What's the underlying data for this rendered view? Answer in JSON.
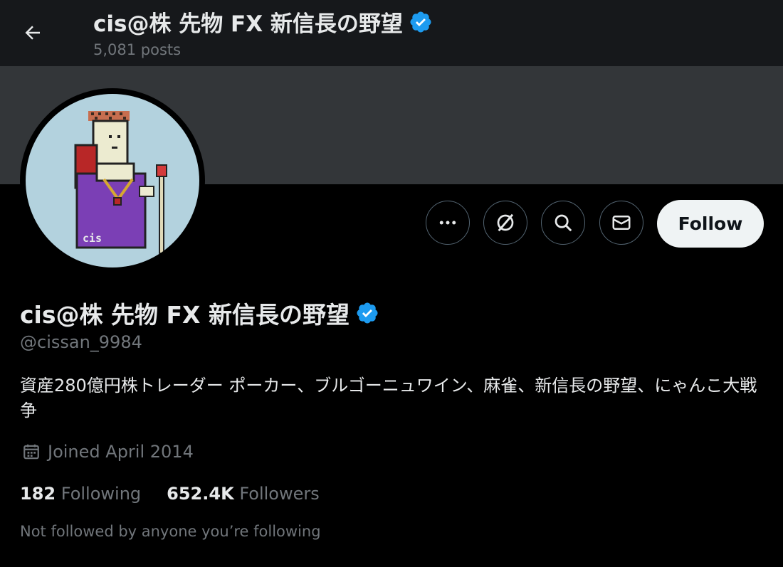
{
  "header": {
    "title": "cis@株 先物 FX 新信長の野望",
    "posts_count": "5,081 posts",
    "back_icon": "arrow-left-icon"
  },
  "profile": {
    "display_name": "cis@株 先物 FX 新信長の野望",
    "verified_icon": "verified-badge-icon",
    "verified_color": "#1d9bf0",
    "handle": "@cissan_9984",
    "bio": "資産280億円株トレーダー ポーカー、ブルゴーニュワイン、麻雀、新信長の野望、にゃんこ大戦争",
    "joined": "Joined April 2014",
    "joined_icon": "calendar-icon",
    "following_count": "182",
    "following_label": "Following",
    "followers_count": "652.4K",
    "followers_label": "Followers",
    "mutuals_note": "Not followed by anyone you’re following"
  },
  "actions": {
    "more_icon": "more-dots-icon",
    "grok_icon": "grok-icon",
    "search_icon": "search-icon",
    "message_icon": "mail-icon",
    "follow_label": "Follow"
  },
  "colors": {
    "background": "#000000",
    "banner": "#333639",
    "avatar_bg": "#b3d2de",
    "primary_text": "#e7e9ea",
    "secondary_text": "#71767b"
  }
}
